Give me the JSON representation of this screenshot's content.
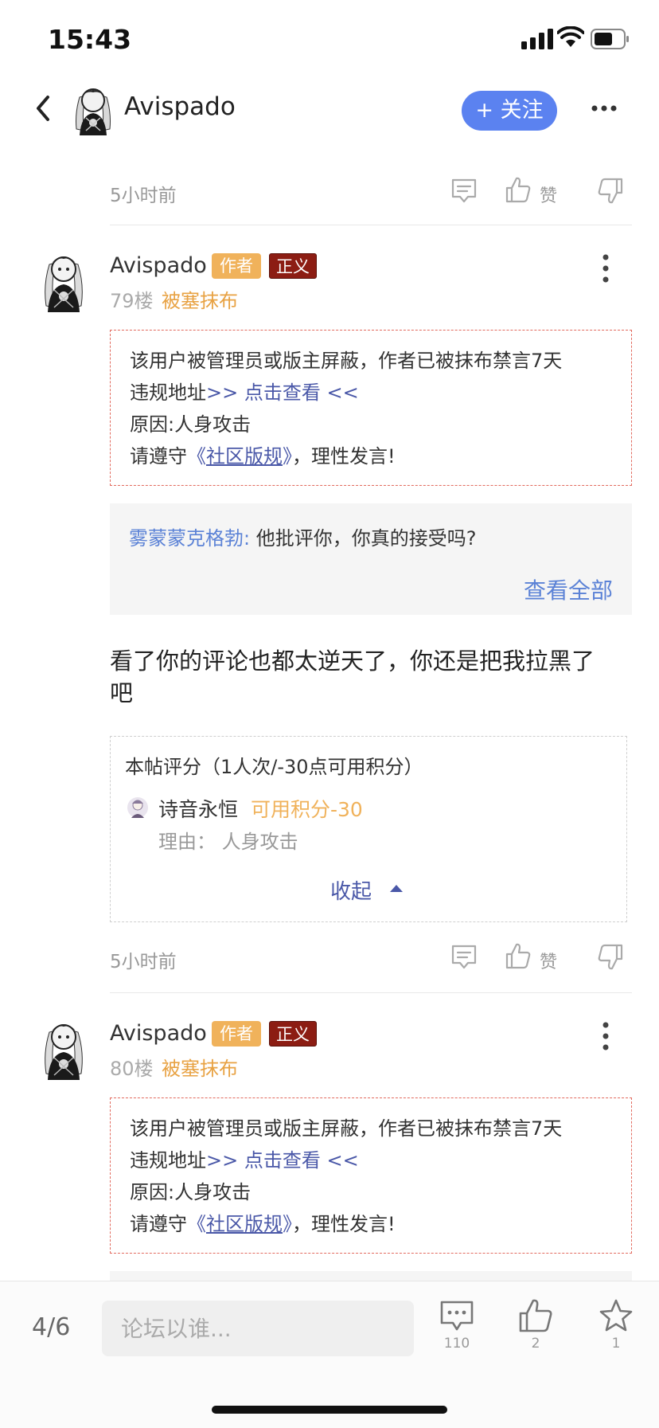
{
  "status_bar": {
    "time": "15:43"
  },
  "header": {
    "username": "Avispado",
    "follow_label": "+ 关注"
  },
  "previous_post": {
    "time": "5小时前",
    "like_label": "赞"
  },
  "posts": [
    {
      "username": "Avispado",
      "badge_author": "作者",
      "badge_justice": "正义",
      "floor": "79楼",
      "status": "被塞抹布",
      "notice": {
        "line1": "该用户被管理员或版主屏蔽，作者已被抹布禁言7天",
        "line2_prefix": "违规地址",
        "line2_link": ">> 点击查看 <<",
        "line3": "原因:人身攻击",
        "line4_prefix": "请遵守",
        "line4_link_open": "《",
        "line4_link": "社区版规",
        "line4_link_close": "》",
        "line4_suffix": "，理性发言!"
      },
      "quote": {
        "author": "雾蒙蒙克格勃:",
        "text": " 他批评你，你真的接受吗?",
        "view_all": "查看全部"
      },
      "comment_line1": "看了你的评论也都太逆天了，你还是把我拉黑了",
      "comment_line2": "吧",
      "rating": {
        "title": "本帖评分（1人次/-30点可用积分）",
        "rater_name": "诗音永恒",
        "rater_points": "可用积分-30",
        "reason": "理由： 人身攻击",
        "collapse_label": "收起"
      },
      "time": "5小时前",
      "like_label": "赞"
    },
    {
      "username": "Avispado",
      "badge_author": "作者",
      "badge_justice": "正义",
      "floor": "80楼",
      "status": "被塞抹布",
      "notice": {
        "line1": "该用户被管理员或版主屏蔽，作者已被抹布禁言7天",
        "line2_prefix": "违规地址",
        "line2_link": ">> 点击查看 <<",
        "line3": "原因:人身攻击",
        "line4_prefix": "请遵守",
        "line4_link_open": "《",
        "line4_link": "社区版规",
        "line4_link_close": "》",
        "line4_suffix": "，理性发言!"
      }
    }
  ],
  "bottom_bar": {
    "page": "4/6",
    "input_placeholder": "论坛以谁...",
    "comment_count": "110",
    "like_count": "2",
    "favorite_count": "1"
  },
  "colors": {
    "accent_blue": "#5b82f0",
    "link_blue": "#4a58a8",
    "author_badge": "#f0b25b",
    "justice_badge": "#8c1d13",
    "status_orange": "#e8a243",
    "notice_border": "#e26a5e"
  }
}
